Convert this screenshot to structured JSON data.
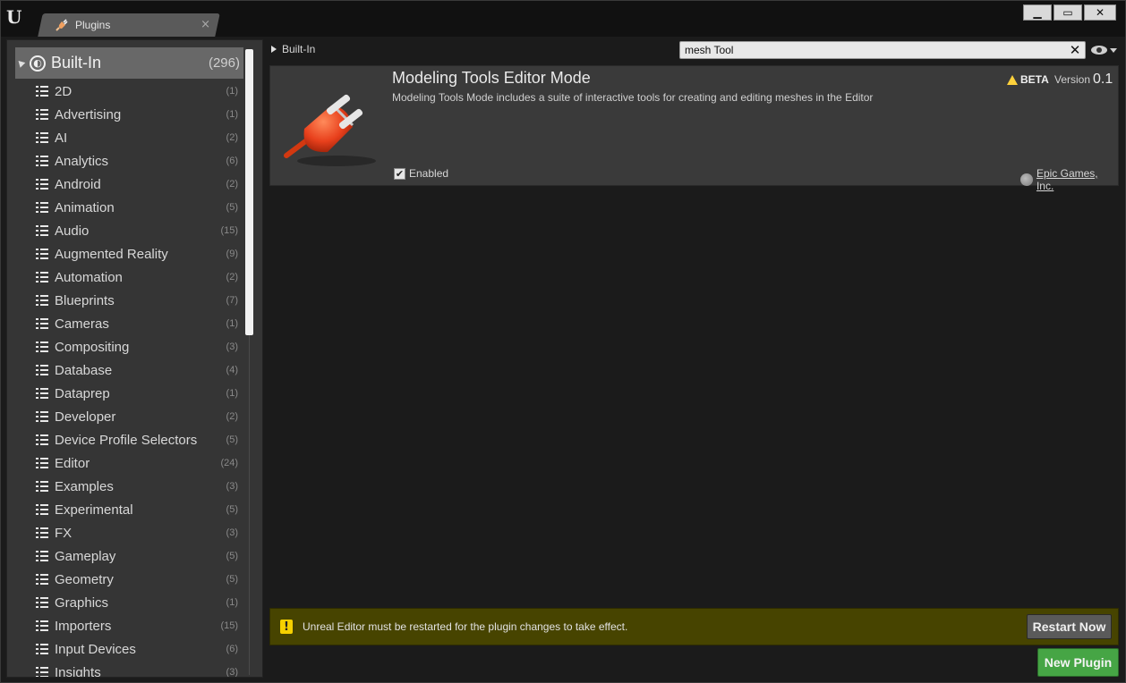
{
  "window": {
    "logo": "U",
    "tab_label": "Plugins",
    "tab_close": "×",
    "minimize": "▁",
    "maximize": "▭",
    "close": "✕"
  },
  "sidebar": {
    "root": {
      "label": "Built-In",
      "count": "(296)"
    },
    "items": [
      {
        "label": "2D",
        "count": "(1)"
      },
      {
        "label": "Advertising",
        "count": "(1)"
      },
      {
        "label": "AI",
        "count": "(2)"
      },
      {
        "label": "Analytics",
        "count": "(6)"
      },
      {
        "label": "Android",
        "count": "(2)"
      },
      {
        "label": "Animation",
        "count": "(5)"
      },
      {
        "label": "Audio",
        "count": "(15)"
      },
      {
        "label": "Augmented Reality",
        "count": "(9)"
      },
      {
        "label": "Automation",
        "count": "(2)"
      },
      {
        "label": "Blueprints",
        "count": "(7)"
      },
      {
        "label": "Cameras",
        "count": "(1)"
      },
      {
        "label": "Compositing",
        "count": "(3)"
      },
      {
        "label": "Database",
        "count": "(4)"
      },
      {
        "label": "Dataprep",
        "count": "(1)"
      },
      {
        "label": "Developer",
        "count": "(2)"
      },
      {
        "label": "Device Profile Selectors",
        "count": "(5)"
      },
      {
        "label": "Editor",
        "count": "(24)"
      },
      {
        "label": "Examples",
        "count": "(3)"
      },
      {
        "label": "Experimental",
        "count": "(5)"
      },
      {
        "label": "FX",
        "count": "(3)"
      },
      {
        "label": "Gameplay",
        "count": "(5)"
      },
      {
        "label": "Geometry",
        "count": "(5)"
      },
      {
        "label": "Graphics",
        "count": "(1)"
      },
      {
        "label": "Importers",
        "count": "(15)"
      },
      {
        "label": "Input Devices",
        "count": "(6)"
      },
      {
        "label": "Insights",
        "count": "(3)"
      }
    ]
  },
  "main": {
    "breadcrumb": "Built-In",
    "search": {
      "value": "mesh Tool",
      "clear": "✕"
    },
    "plugin": {
      "title": "Modeling Tools Editor Mode",
      "description": "Modeling Tools Mode includes a suite of interactive tools for creating and editing meshes in the Editor",
      "beta_label": "BETA",
      "version_label": "Version",
      "version": "0.1",
      "enabled_label": "Enabled",
      "enabled": true,
      "publisher": "Epic Games, Inc."
    },
    "notice": {
      "icon": "!",
      "text": "Unreal Editor must be restarted for the plugin changes to take effect.",
      "restart_label": "Restart Now"
    },
    "new_plugin_label": "New Plugin"
  },
  "colors": {
    "accent_green": "#46a545",
    "notice_bg": "#474400",
    "plug_red": "#e8401c"
  }
}
